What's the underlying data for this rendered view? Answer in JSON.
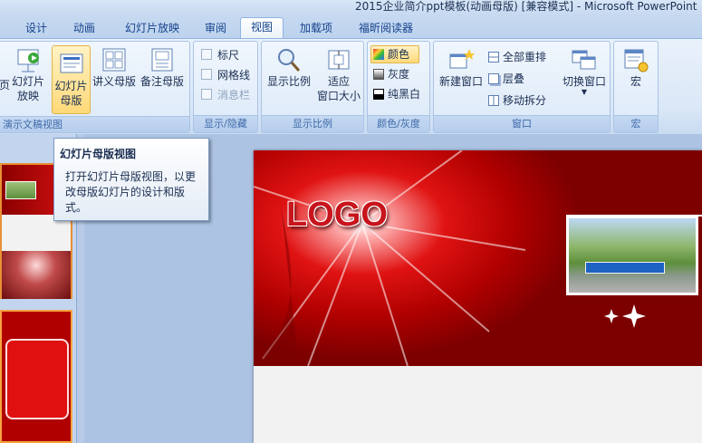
{
  "window": {
    "title": "2015企业简介ppt模板(动画母版) [兼容模式] - Microsoft PowerPoint"
  },
  "tabs": [
    {
      "label": "设计"
    },
    {
      "label": "动画"
    },
    {
      "label": "幻灯片放映"
    },
    {
      "label": "审阅"
    },
    {
      "label": "视图",
      "active": true
    },
    {
      "label": "加载项"
    },
    {
      "label": "福昕阅读器"
    }
  ],
  "ribbon": {
    "presentation_views": {
      "label": "演示文稿视图",
      "partial_button": "页",
      "slideshow_button": "幻灯片\n放映",
      "slide_master": "幻灯片\n母版",
      "handout_master": "讲义母版",
      "notes_master": "备注母版"
    },
    "show_hide": {
      "label": "显示/隐藏",
      "ruler": "标尺",
      "gridlines": "网格线",
      "message_bar": "消息栏"
    },
    "zoom": {
      "label": "显示比例",
      "zoom_button": "显示比例",
      "fit_window": "适应\n窗口大小"
    },
    "color_grayscale": {
      "label": "颜色/灰度",
      "color": "颜色",
      "grayscale": "灰度",
      "black_white": "纯黑白"
    },
    "window": {
      "label": "窗口",
      "new_window": "新建窗口",
      "arrange_all": "全部重排",
      "cascade": "层叠",
      "move_split": "移动拆分",
      "switch_windows": "切换窗口"
    },
    "macros": {
      "label": "宏",
      "macros_button": "宏"
    }
  },
  "tooltip": {
    "title": "幻灯片母版视图",
    "body": "打开幻灯片母版视图，以更改母版幻灯片的设计和版式。"
  },
  "slide": {
    "logo_text": "LOGO",
    "banner_color": "#c00000"
  },
  "colors": {
    "ribbon_bg": "#dbe8f7",
    "active_button": "#ffd979",
    "group_label_text": "#3e6aaa"
  }
}
